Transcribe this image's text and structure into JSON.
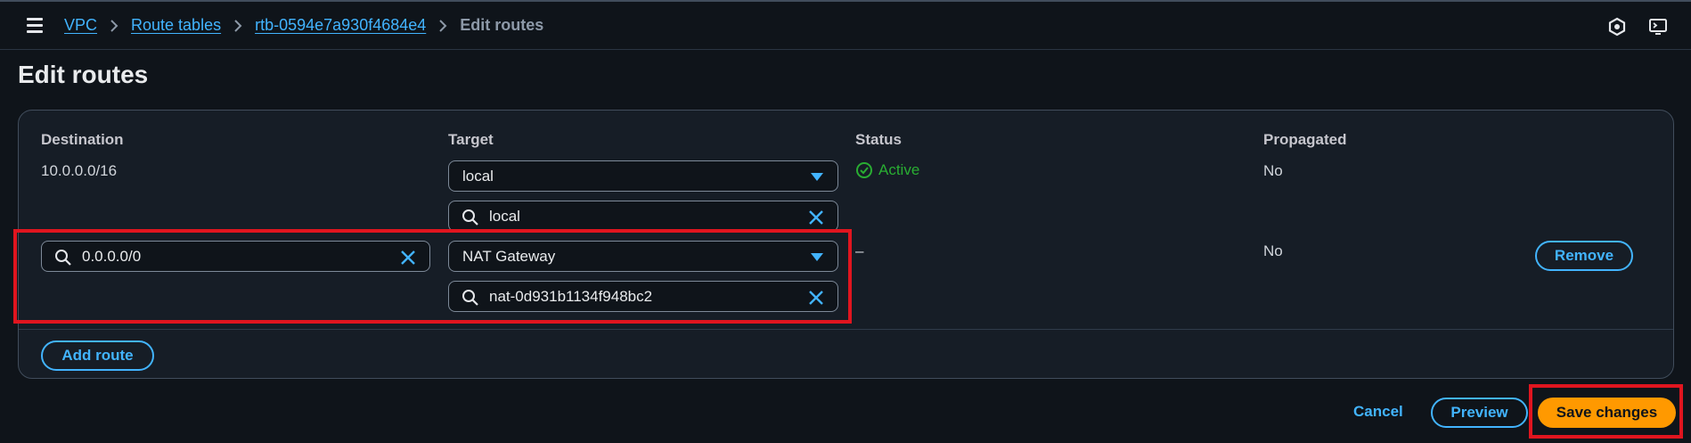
{
  "breadcrumb": {
    "items": [
      "VPC",
      "Route tables",
      "rtb-0594e7a930f4684e4"
    ],
    "current": "Edit routes"
  },
  "page": {
    "title": "Edit routes"
  },
  "table": {
    "columns": [
      "Destination",
      "Target",
      "Status",
      "Propagated"
    ],
    "rows": [
      {
        "destination": "10.0.0.0/16",
        "target_type": "local",
        "target_search": "local",
        "status": "Active",
        "propagated": "No"
      },
      {
        "destination": "0.0.0.0/0",
        "target_type": "NAT Gateway",
        "target_search": "nat-0d931b1134f948bc2",
        "status": "–",
        "propagated": "No",
        "remove_label": "Remove"
      }
    ],
    "add_route_label": "Add route"
  },
  "footer": {
    "cancel_label": "Cancel",
    "preview_label": "Preview",
    "save_label": "Save changes"
  },
  "colors": {
    "link": "#42b4ff",
    "primary": "#ff9900",
    "success": "#29ad32",
    "highlight": "#e0151f"
  },
  "icons": [
    "menu-icon",
    "chevron-right-icon",
    "search-icon",
    "clear-icon",
    "caret-down-icon",
    "status-success-icon",
    "notifications-icon",
    "cloudshell-icon"
  ]
}
